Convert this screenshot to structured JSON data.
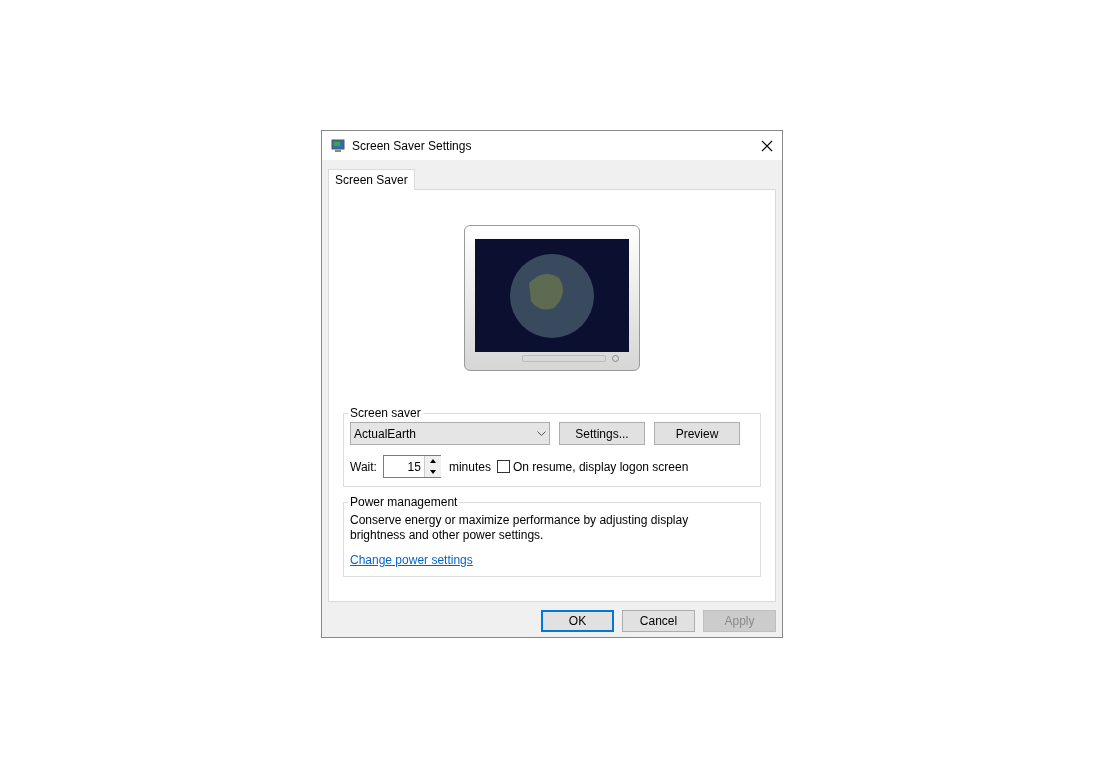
{
  "window": {
    "title": "Screen Saver Settings"
  },
  "tabs": [
    {
      "label": "Screen Saver",
      "selected": true
    }
  ],
  "screen_saver": {
    "legend": "Screen saver",
    "dropdown": "ActualEarth",
    "buttons": [
      "Settings...",
      "Preview"
    ],
    "wait_label": "Wait:",
    "wait_value": "15",
    "unit": "minutes",
    "logon_checkbox": {
      "label": "On resume, display logon screen",
      "checked": false
    }
  },
  "power": {
    "legend": "Power management",
    "text": "Conserve energy or maximize performance by adjusting display brightness and other power settings.",
    "link": "Change power settings"
  },
  "buttons": [
    {
      "label": "OK",
      "default": true,
      "disabled": false
    },
    {
      "label": "Cancel",
      "default": false,
      "disabled": false
    },
    {
      "label": "Apply",
      "default": false,
      "disabled": true
    }
  ]
}
